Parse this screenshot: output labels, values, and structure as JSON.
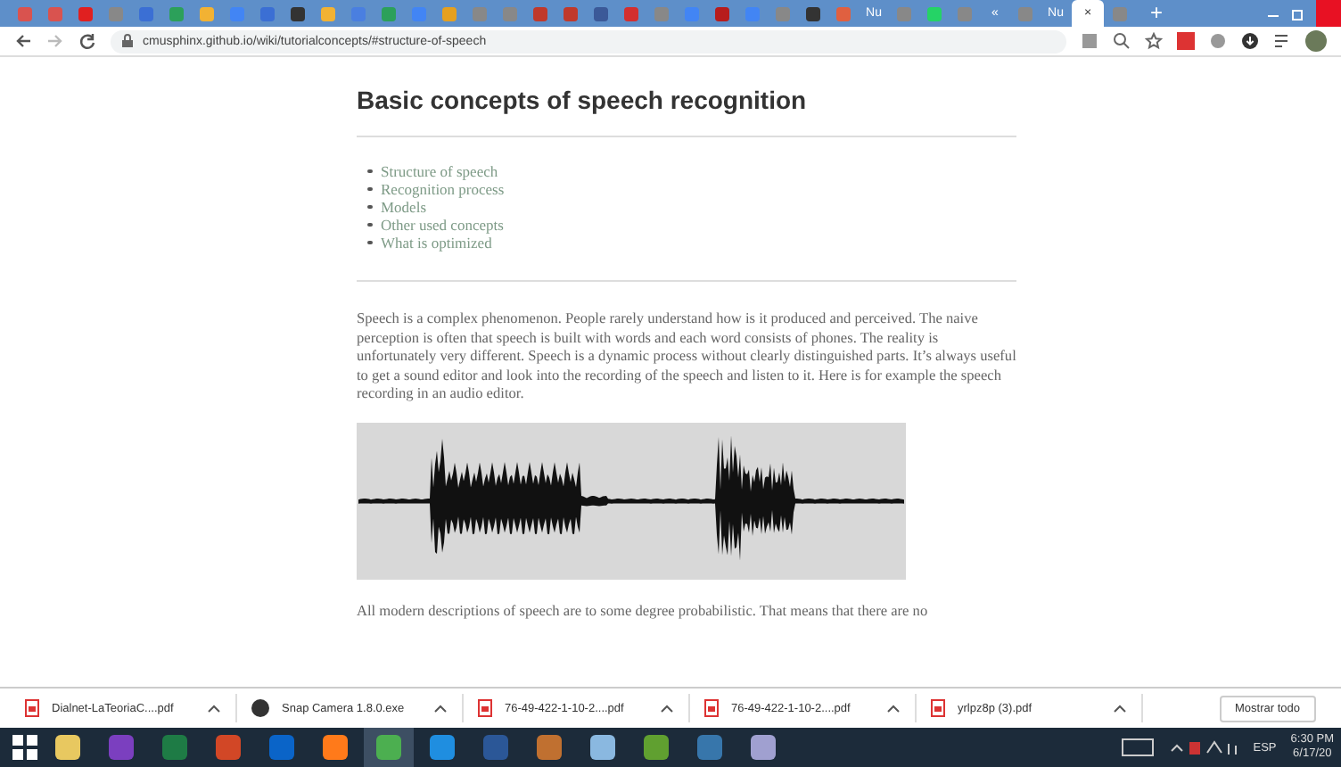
{
  "browser": {
    "tabs": [
      {
        "color": "#d9534f",
        "selected": false
      },
      {
        "color": "#d9534f",
        "selected": false
      },
      {
        "color": "#e02020",
        "selected": false
      },
      {
        "color": "#888888",
        "selected": false
      },
      {
        "color": "#3b6fd4",
        "selected": false
      },
      {
        "color": "#2ca05a",
        "selected": false
      },
      {
        "color": "#f2b233",
        "selected": false
      },
      {
        "color": "#4285f4",
        "selected": false
      },
      {
        "color": "#3b6fd4",
        "selected": false
      },
      {
        "color": "#333333",
        "selected": false
      },
      {
        "color": "#f2b233",
        "selected": false
      },
      {
        "color": "#4a7fe0",
        "selected": false
      },
      {
        "color": "#2ca05a",
        "selected": false
      },
      {
        "color": "#4285f4",
        "selected": false
      },
      {
        "color": "#e5a020",
        "selected": false
      },
      {
        "color": "#888888",
        "selected": false
      },
      {
        "color": "#888888",
        "selected": false
      },
      {
        "color": "#c0392b",
        "selected": false
      },
      {
        "color": "#c0392b",
        "selected": false
      },
      {
        "color": "#3b5998",
        "selected": false
      },
      {
        "color": "#d32f2f",
        "selected": false
      },
      {
        "color": "#888888",
        "selected": false
      },
      {
        "color": "#4285f4",
        "selected": false
      },
      {
        "color": "#b71c1c",
        "selected": false
      },
      {
        "color": "#4285f4",
        "selected": false
      },
      {
        "color": "#888888",
        "selected": false
      },
      {
        "color": "#333333",
        "selected": false
      },
      {
        "color": "#e06040",
        "selected": false
      },
      {
        "label": "Nu",
        "selected": false
      },
      {
        "color": "#888888",
        "selected": false
      },
      {
        "color": "#25d366",
        "selected": false
      },
      {
        "color": "#888888",
        "selected": false
      },
      {
        "label": "«",
        "selected": false
      },
      {
        "color": "#888888",
        "selected": false
      },
      {
        "label": "Nu",
        "selected": false
      },
      {
        "label": "×",
        "selected": true
      },
      {
        "color": "#888888",
        "selected": false
      }
    ],
    "new_tab": "+",
    "url": "cmusphinx.github.io/wiki/tutorialconcepts/#structure-of-speech"
  },
  "page": {
    "title": "Basic concepts of speech recognition",
    "toc": [
      "Structure of speech",
      "Recognition process",
      "Models",
      "Other used concepts",
      "What is optimized"
    ],
    "paragraph": "Speech is a complex phenomenon. People rarely understand how is it produced and perceived. The naive perception is often that speech is built with words and each word consists of phones. The reality is unfortunately very different. Speech is a dynamic process without clearly distinguished parts. It’s always useful to get a sound editor and look into the recording of the speech and listen to it. Here is for example the speech recording in an audio editor.",
    "next_paragraph": "All modern descriptions of speech are to some degree probabilistic. That means that there are no"
  },
  "downloads": {
    "items": [
      {
        "name": "Dialnet-LaTeoriaC....pdf",
        "kind": "pdf"
      },
      {
        "name": "Snap Camera 1.8.0.exe",
        "kind": "exe"
      },
      {
        "name": "76-49-422-1-10-2....pdf",
        "kind": "pdf"
      },
      {
        "name": "76-49-422-1-10-2....pdf",
        "kind": "pdf"
      },
      {
        "name": "yrlpz8p (3).pdf",
        "kind": "pdf"
      }
    ],
    "show_all": "Mostrar todo"
  },
  "taskbar": {
    "apps": [
      {
        "color": "#e8c860",
        "selected": false
      },
      {
        "color": "#7b3fbf",
        "selected": false
      },
      {
        "color": "#1e7b45",
        "selected": false
      },
      {
        "color": "#d24726",
        "selected": false
      },
      {
        "color": "#0a64c8",
        "selected": false
      },
      {
        "color": "#ff7a1a",
        "selected": false
      },
      {
        "color": "#4caf50",
        "selected": true
      },
      {
        "color": "#1f8ee0",
        "selected": false
      },
      {
        "color": "#2b5797",
        "selected": false
      },
      {
        "color": "#c07030",
        "selected": false
      },
      {
        "color": "#8ab8e0",
        "selected": false
      },
      {
        "color": "#60a030",
        "selected": false
      },
      {
        "color": "#3776ab",
        "selected": false
      },
      {
        "color": "#a0a0d0",
        "selected": false
      }
    ],
    "language": "ESP",
    "time": "6:30 PM",
    "date": "6/17/20"
  }
}
